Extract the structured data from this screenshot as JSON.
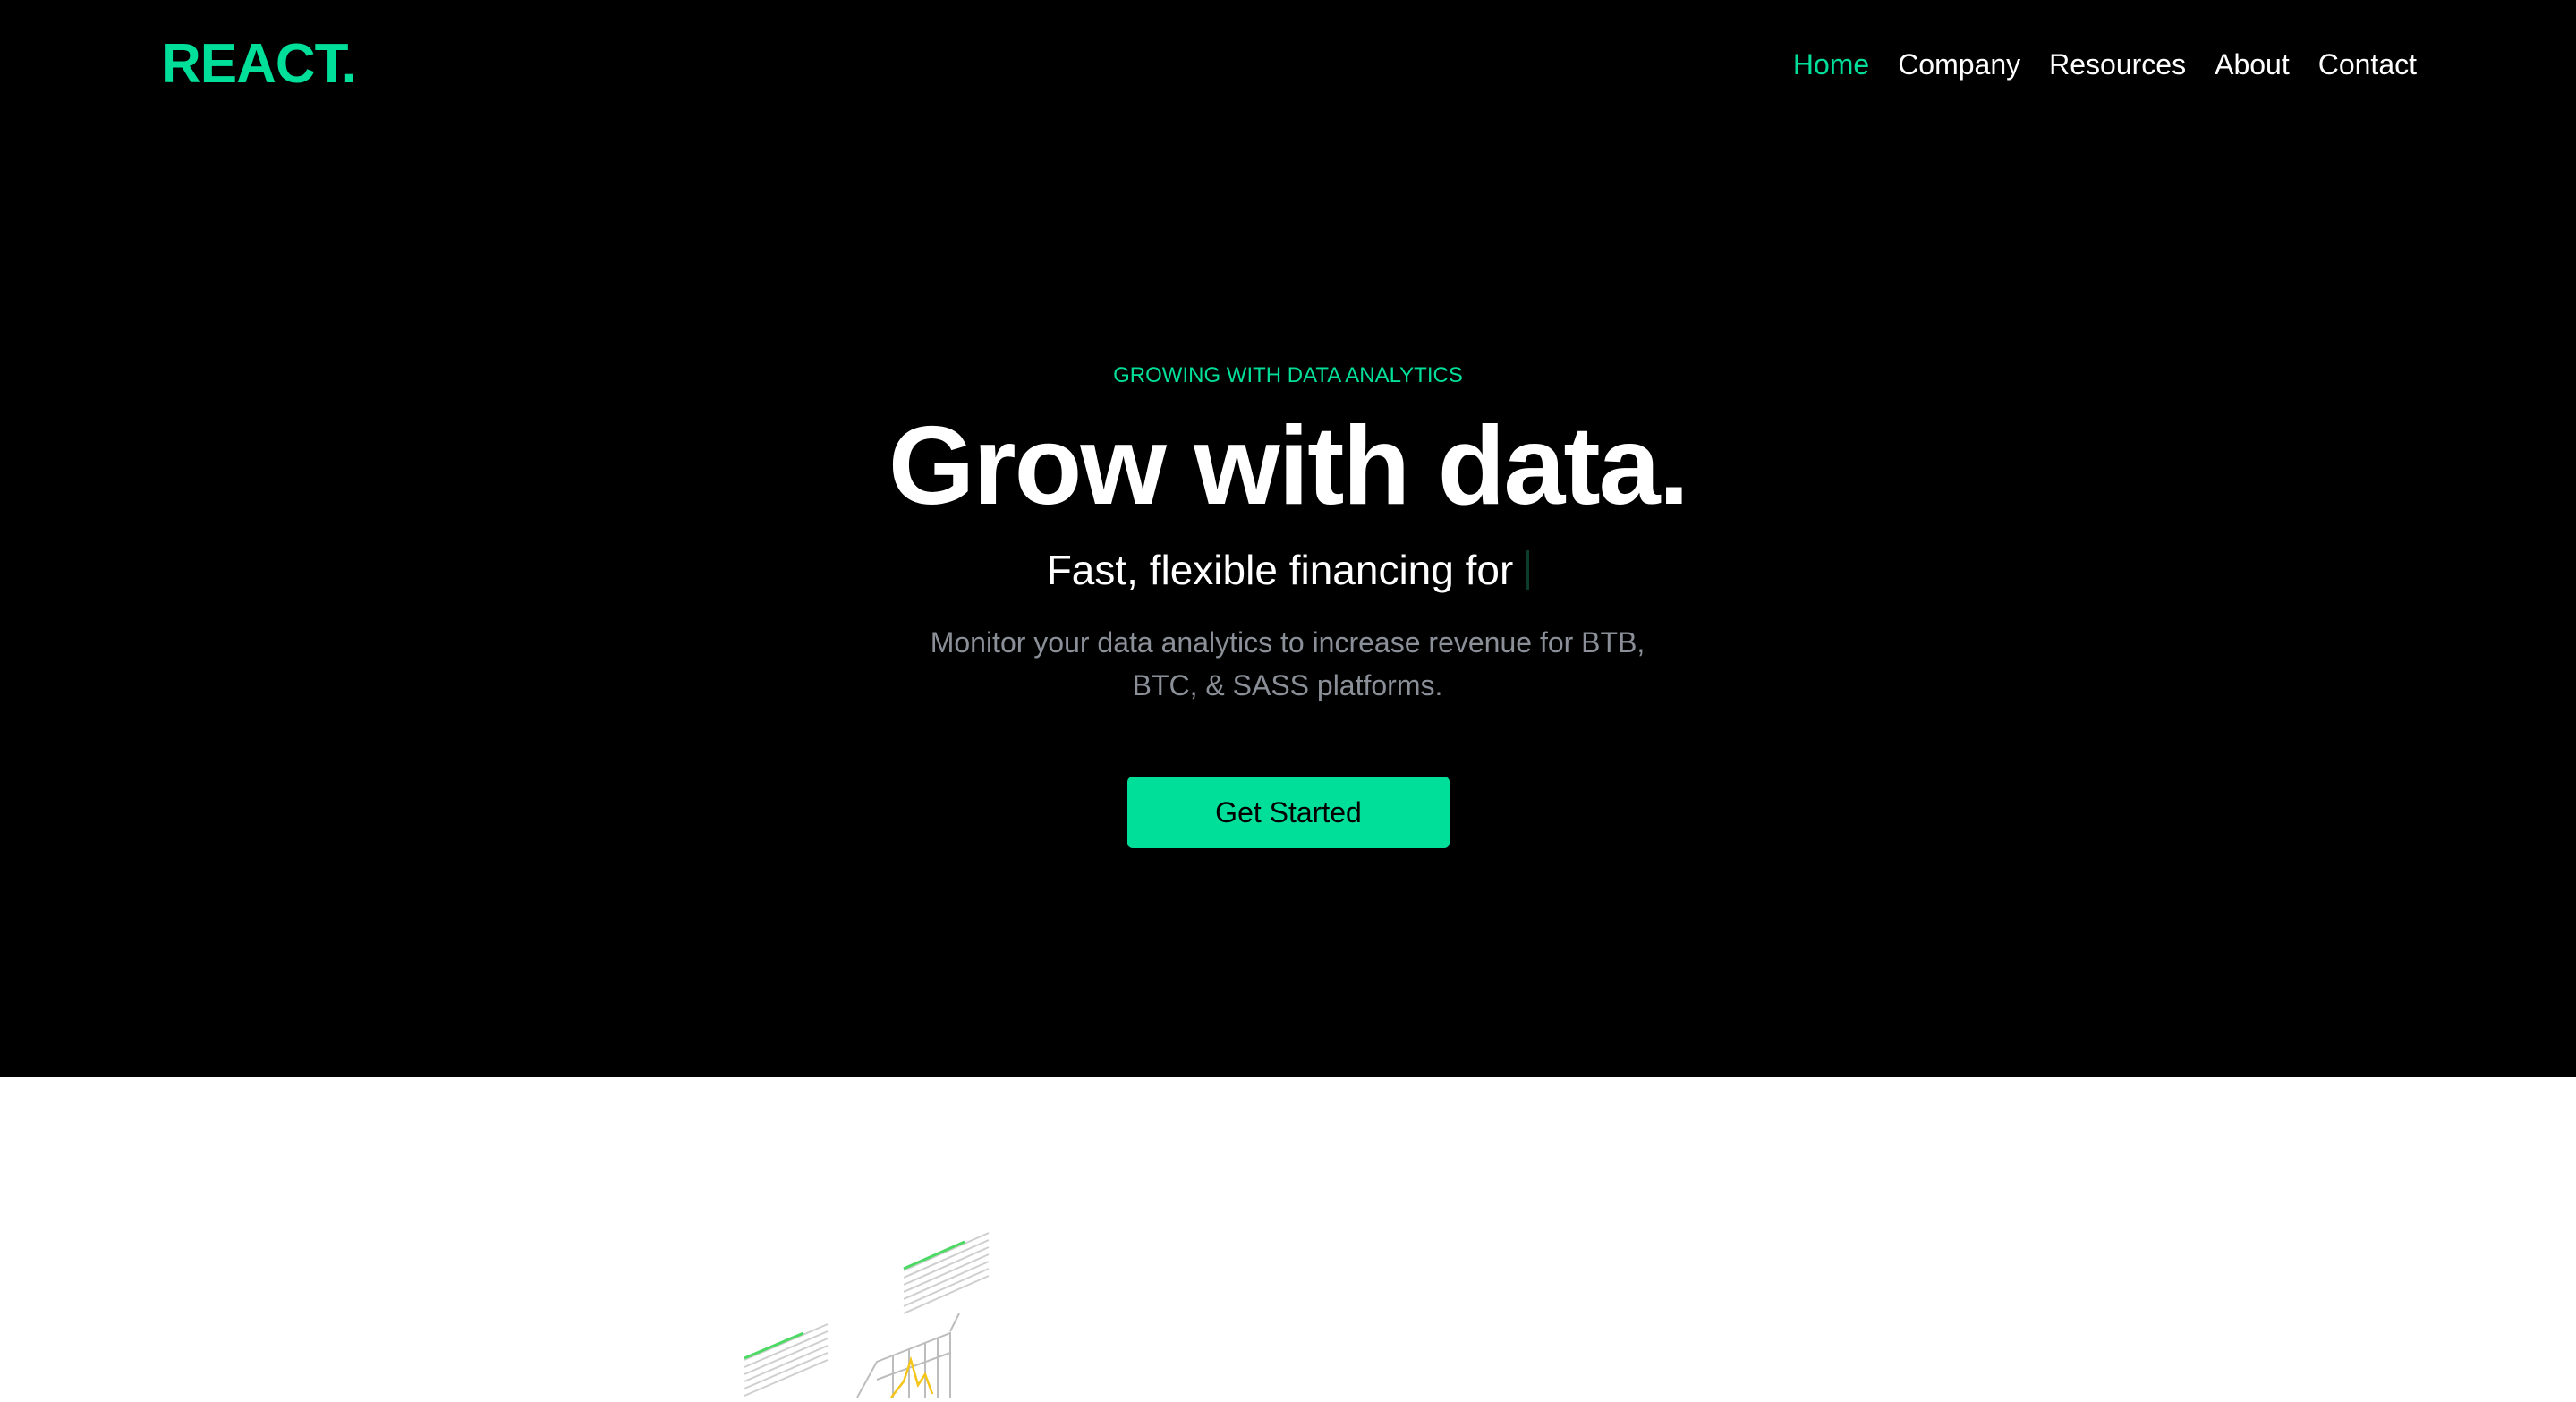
{
  "brand": {
    "logo": "REACT.",
    "accent_color": "#00df9a"
  },
  "nav": {
    "items": [
      {
        "label": "Home",
        "active": true
      },
      {
        "label": "Company"
      },
      {
        "label": "Resources"
      },
      {
        "label": "About"
      },
      {
        "label": "Contact"
      }
    ]
  },
  "hero": {
    "eyebrow": "GROWING WITH DATA ANALYTICS",
    "headline": "Grow with data.",
    "subhead": "Fast, flexible financing for",
    "description": "Monitor your data analytics to increase revenue for BTB, BTC, & SASS platforms.",
    "cta_label": "Get Started",
    "background_color": "#000000"
  },
  "illustration": {
    "icon": "data-analytics-illustration"
  }
}
